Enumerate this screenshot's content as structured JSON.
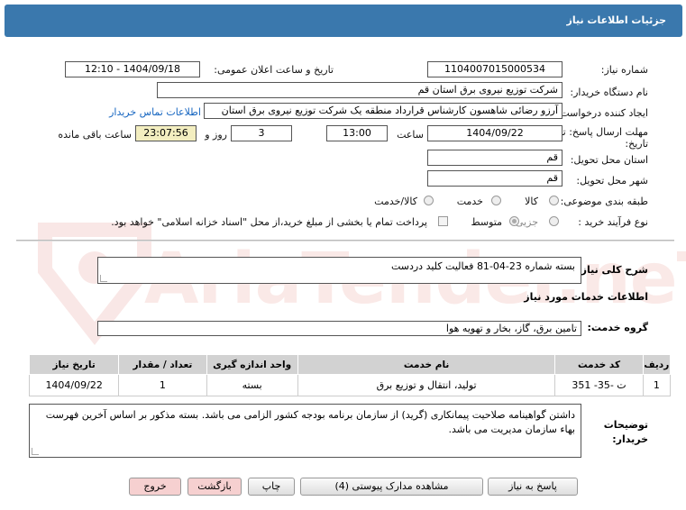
{
  "header": {
    "title": "جزئیات اطلاعات نیاز"
  },
  "watermark": {
    "text": "AriaTender.neT"
  },
  "fields": {
    "need_number_label": "شماره نیاز:",
    "need_number": "1104007015000534",
    "announce_label": "تاریخ و ساعت اعلان عمومی:",
    "announce_value": "1404/09/18 - 12:10",
    "buyer_org_label": "نام دستگاه خریدار:",
    "buyer_org": "شرکت توزیع نیروی برق استان قم",
    "creator_label": "ایجاد کننده درخواست:",
    "creator": "آرزو رضائی شاهسون کارشناس قرارداد منطقه یک شرکت توزیع نیروی برق استان",
    "contact_link": "اطلاعات تماس خریدار",
    "deadline_label_1": "مهلت ارسال پاسخ: تا",
    "deadline_label_2": "تاریخ:",
    "deadline_date": "1404/09/22",
    "time_label": "ساعت",
    "deadline_time": "13:00",
    "days_value": "3",
    "days_label": "روز و",
    "remaining_time": "23:07:56",
    "remaining_label": "ساعت باقی مانده",
    "province_label": "استان محل تحویل:",
    "province": "قم",
    "city_label": "شهر محل تحویل:",
    "city": "قم",
    "category_label": "طبقه بندی موضوعی:",
    "category_options": [
      "کالا",
      "خدمت",
      "کالا/خدمت"
    ],
    "process_label": "نوع فرآیند خرید :",
    "process_options": [
      "جزیی",
      "متوسط"
    ],
    "payment_note": "پرداخت تمام یا بخشی از مبلغ خرید،از محل \"اسناد خزانه اسلامی\" خواهد بود."
  },
  "summary": {
    "label": "شرح کلی نیاز:",
    "value": "بسته شماره 23-04-81 فعالیت کلید دردست"
  },
  "services": {
    "section_title": "اطلاعات خدمات مورد نیاز",
    "group_label": "گروه خدمت:",
    "group_value": "تامین برق، گاز، بخار و تهویه هوا",
    "columns": [
      "ردیف",
      "کد خدمت",
      "نام خدمت",
      "واحد اندازه گیری",
      "تعداد / مقدار",
      "تاریخ نیاز"
    ],
    "rows": [
      [
        "1",
        "ت -35- 351",
        "تولید، انتقال و توزیع برق",
        "بسته",
        "1",
        "1404/09/22"
      ]
    ]
  },
  "notes": {
    "label_1": "توضیحات",
    "label_2": "خریدار:",
    "text": "داشتن گواهینامه صلاحیت پیمانکاری (گرید) از سازمان برنامه بودجه کشور الزامی می باشد. بسته مذکور بر اساس آخرین فهرست بهاء سازمان مدیریت می باشد."
  },
  "buttons": {
    "reply": "پاسخ به نیاز",
    "attachments": "مشاهده مدارک پیوستی (4)",
    "print": "چاپ",
    "back": "بازگشت",
    "exit": "خروج"
  }
}
